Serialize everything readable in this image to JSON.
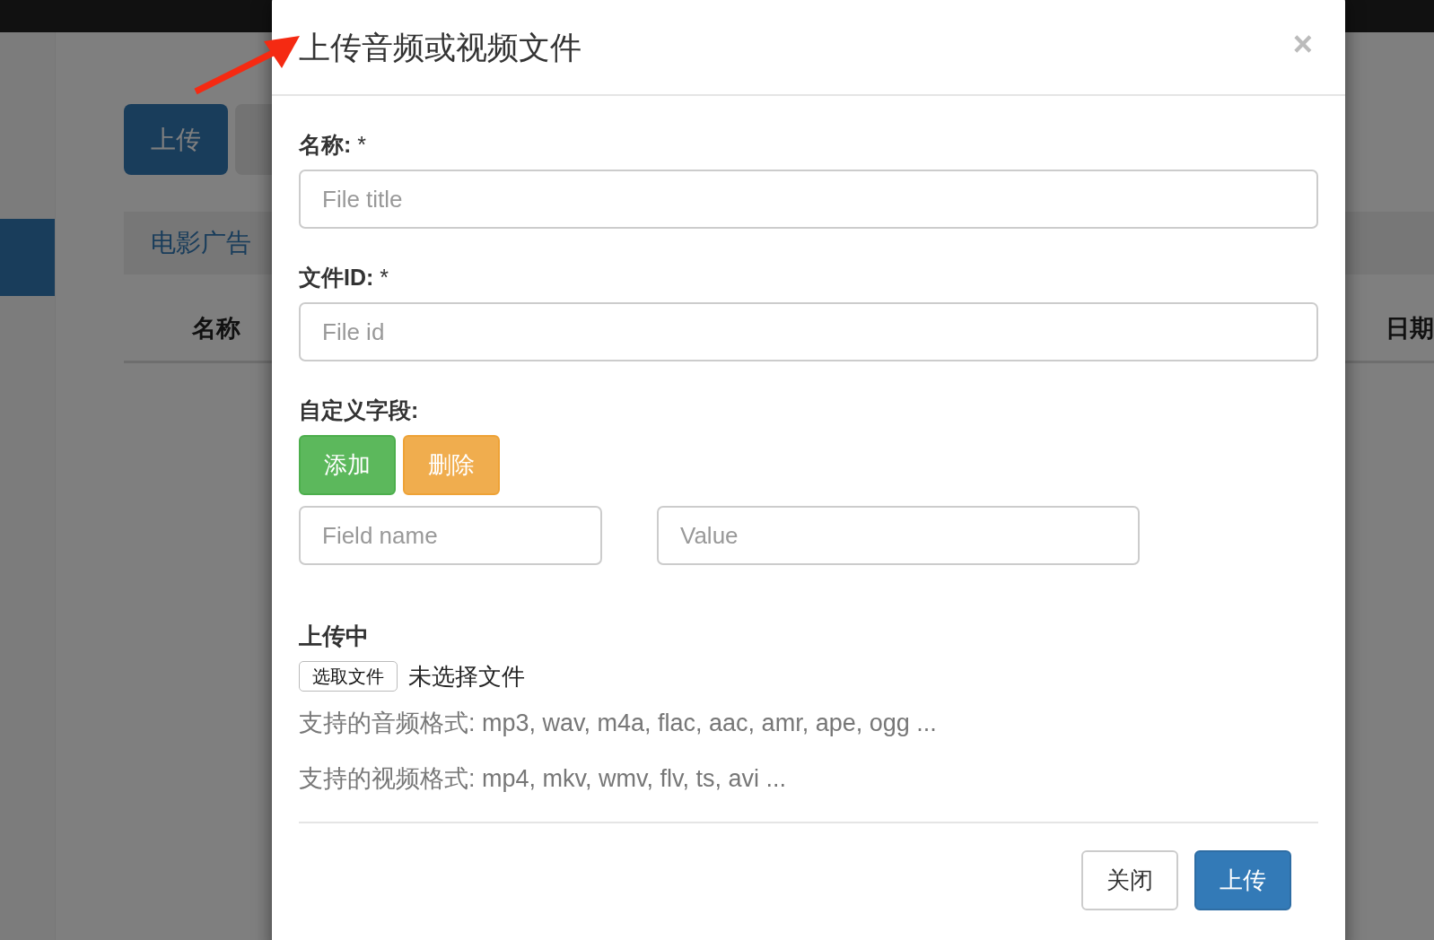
{
  "background": {
    "sidebar": {
      "items": [
        {
          "selected": true
        }
      ]
    },
    "toolbar": {
      "buttons": [
        {
          "label": "上传",
          "kind": "primary"
        },
        {
          "kind": "default"
        }
      ]
    },
    "category_bar": {
      "items": [
        "电影广告"
      ]
    },
    "table": {
      "columns": [
        "名称",
        "日期"
      ]
    }
  },
  "modal": {
    "title": "上传音频或视频文件",
    "close": "×",
    "fields": [
      {
        "label": "名称:",
        "required_mark": "*",
        "placeholder": "File title"
      },
      {
        "label": "文件ID:",
        "required_mark": "*",
        "placeholder": "File id"
      }
    ],
    "custom_fields": {
      "label": "自定义字段:",
      "buttons": [
        {
          "label": "添加",
          "kind": "success"
        },
        {
          "label": "删除",
          "kind": "warning"
        }
      ],
      "inputs": [
        {
          "placeholder": "Field name"
        },
        {
          "placeholder": "Value"
        }
      ]
    },
    "upload": {
      "label": "上传中",
      "choose_button": "选取文件",
      "file_status": "未选择文件",
      "help": [
        "支持的音频格式: mp3, wav, m4a, flac, aac, amr, ape, ogg ...",
        "支持的视频格式: mp4, mkv, wmv, flv, ts, avi ..."
      ]
    },
    "footer_buttons": [
      {
        "label": "关闭",
        "kind": "default"
      },
      {
        "label": "上传",
        "kind": "primary"
      }
    ]
  }
}
